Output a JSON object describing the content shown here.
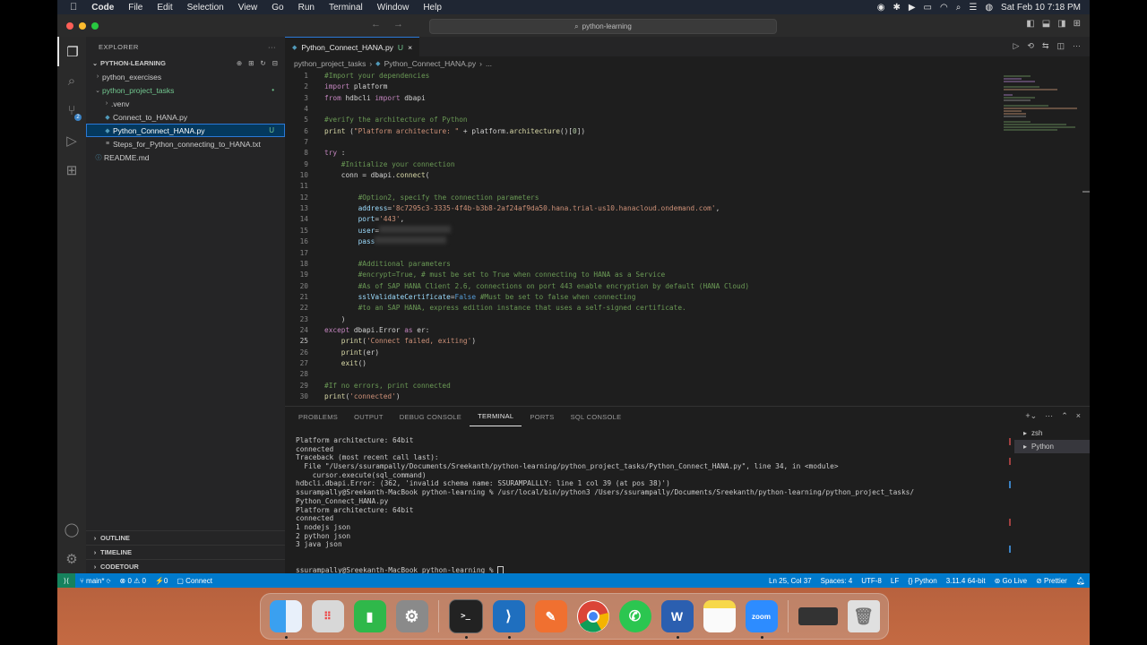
{
  "menubar": {
    "apple": "",
    "app": "Code",
    "items": [
      "File",
      "Edit",
      "Selection",
      "View",
      "Go",
      "Run",
      "Terminal",
      "Window",
      "Help"
    ],
    "clock": "Sat Feb 10  7:18 PM"
  },
  "titlebar": {
    "search": "python-learning"
  },
  "sidebar": {
    "title": "EXPLORER",
    "root": "PYTHON-LEARNING",
    "tree": [
      {
        "label": "python_exercises",
        "type": "folder",
        "depth": 1,
        "expanded": false
      },
      {
        "label": "python_project_tasks",
        "type": "folder",
        "depth": 1,
        "expanded": true,
        "status": "•"
      },
      {
        "label": ".venv",
        "type": "folder",
        "depth": 2,
        "expanded": false
      },
      {
        "label": "Connect_to_HANA.py",
        "type": "py",
        "depth": 2
      },
      {
        "label": "Python_Connect_HANA.py",
        "type": "py",
        "depth": 2,
        "status": "U",
        "selected": true
      },
      {
        "label": "Steps_for_Python_connecting_to_HANA.txt",
        "type": "txt",
        "depth": 2
      },
      {
        "label": "README.md",
        "type": "md",
        "depth": 1
      }
    ],
    "sections": [
      "OUTLINE",
      "TIMELINE",
      "CODETOUR"
    ]
  },
  "editor": {
    "tab": {
      "label": "Python_Connect_HANA.py",
      "status": "U"
    },
    "breadcrumb": [
      "python_project_tasks",
      "Python_Connect_HANA.py",
      "..."
    ],
    "current_line": 25
  },
  "panel": {
    "tabs": [
      "PROBLEMS",
      "OUTPUT",
      "DEBUG CONSOLE",
      "TERMINAL",
      "PORTS",
      "SQL CONSOLE"
    ],
    "active_tab": "TERMINAL",
    "terminal_lines": [
      "Platform architecture: 64bit",
      "connected",
      "Traceback (most recent call last):",
      "  File \"/Users/ssurampally/Documents/Sreekanth/python-learning/python_project_tasks/Python_Connect_HANA.py\", line 34, in <module>",
      "    cursor.execute(sql_command)",
      "hdbcli.dbapi.Error: (362, 'invalid schema name: SSURAMPALLLY: line 1 col 39 (at pos 38)')",
      "ssurampally@Sreekanth-MacBook python-learning % /usr/local/bin/python3 /Users/ssurampally/Documents/Sreekanth/python-learning/python_project_tasks/",
      "Python_Connect_HANA.py",
      "Platform architecture: 64bit",
      "connected",
      "1 nodejs json",
      "2 python json",
      "3 java json",
      "",
      "",
      "ssurampally@Sreekanth-MacBook python-learning % "
    ],
    "terminals": [
      "zsh",
      "Python"
    ]
  },
  "statusbar": {
    "branch": "main*",
    "problems": "⊗ 0 ⚠ 0",
    "ports": "⚡0",
    "connect": "Connect",
    "cursor": "Ln 25, Col 37",
    "spaces": "Spaces: 4",
    "encoding": "UTF-8",
    "eol": "LF",
    "language": "Python",
    "interpreter": "3.11.4 64-bit",
    "golive": "Go Live",
    "prettier": "Prettier"
  },
  "dock": {
    "apps": [
      "Finder",
      "Launchpad",
      "Numbers",
      "System Settings",
      "Terminal",
      "Visual Studio Code",
      "Pages",
      "Chrome",
      "WhatsApp",
      "Word",
      "Notes",
      "zoom",
      "Screen",
      "Trash"
    ],
    "zoom_label": "zoom",
    "word_label": "W"
  },
  "colors": {
    "accent": "#007acc",
    "editor_bg": "#1e1e1e",
    "sidebar_bg": "#252526",
    "selection": "#04395e",
    "untracked": "#73c991"
  }
}
